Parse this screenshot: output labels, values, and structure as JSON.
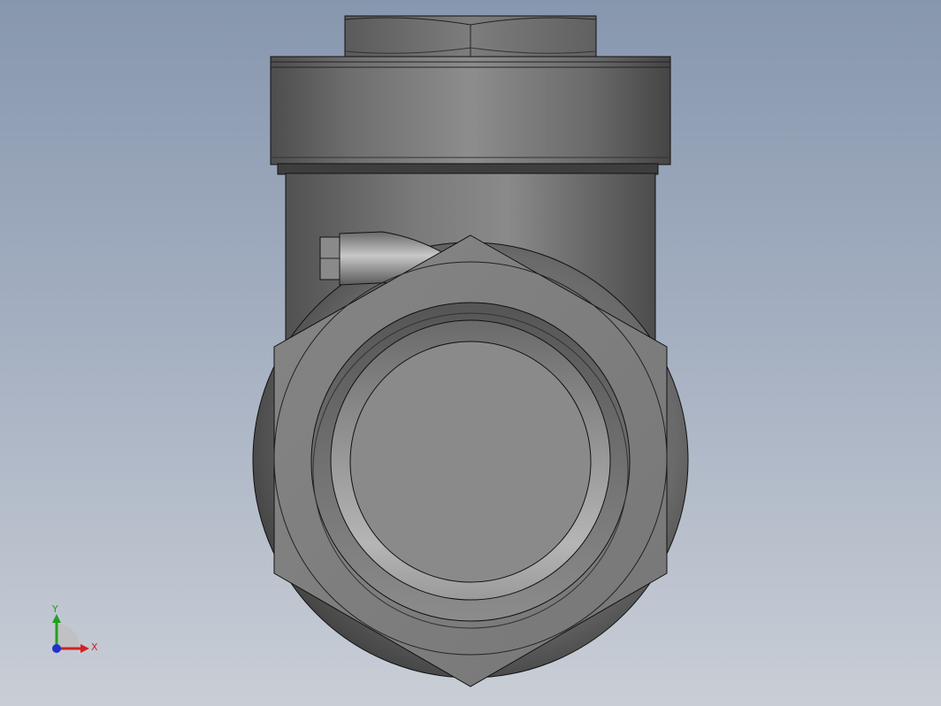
{
  "scene": {
    "part": "cad-part-front-view"
  },
  "triad": {
    "x_label": "X",
    "y_label": "Y",
    "x_color": "#d42020",
    "y_color": "#20a020",
    "z_color": "#2030d0"
  },
  "colors": {
    "background_top": "#8797ae",
    "background_bottom": "#c9ced6",
    "edge": "#111111"
  }
}
